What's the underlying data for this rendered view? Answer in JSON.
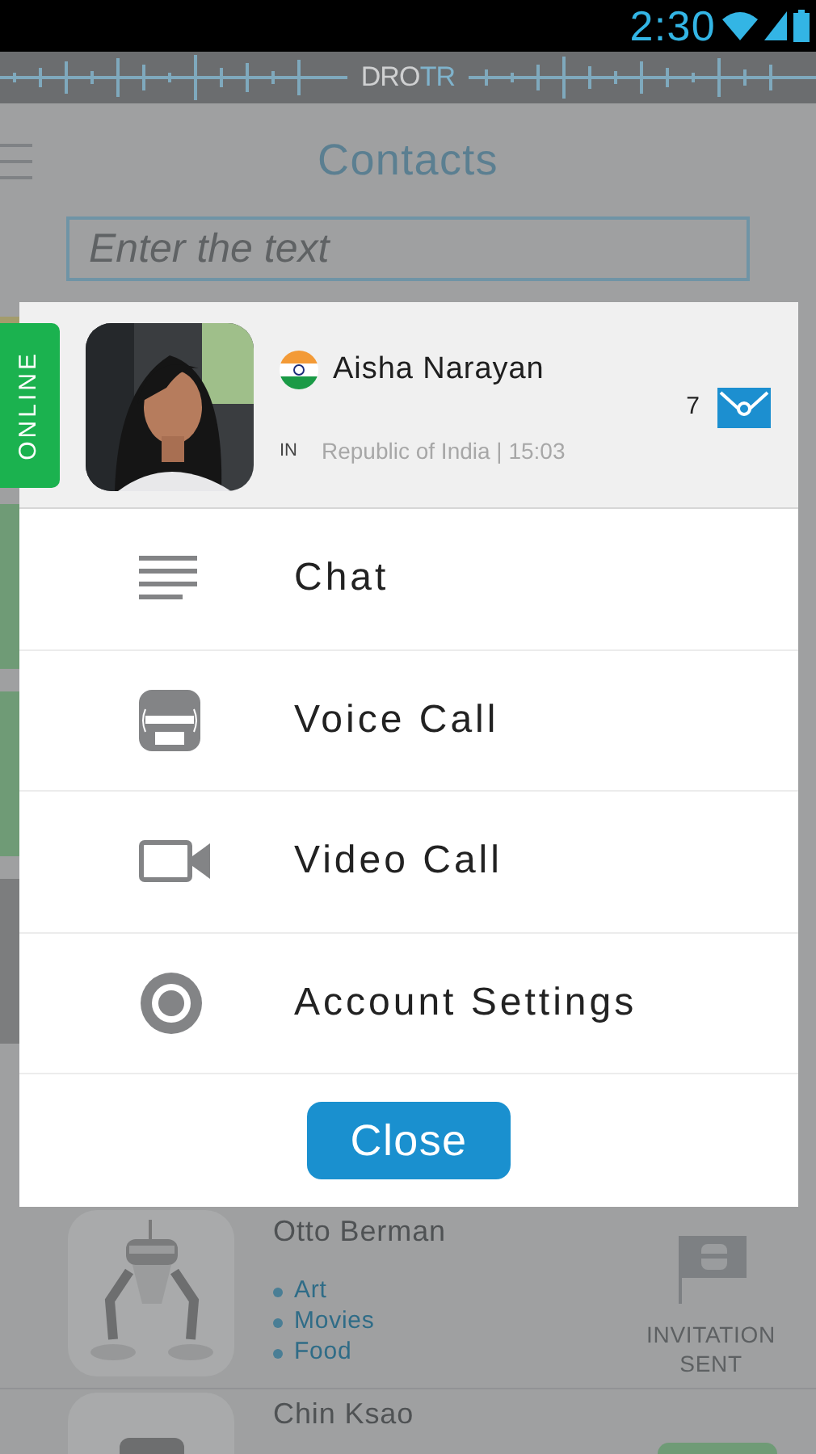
{
  "status_bar": {
    "time": "2:30"
  },
  "banner": {
    "logo": [
      {
        "text": "DRO",
        "accent": false
      },
      {
        "text": "TR",
        "accent": true
      }
    ]
  },
  "header": {
    "title": "Contacts"
  },
  "search": {
    "placeholder": "Enter the text"
  },
  "hidden_rows": [
    {
      "color": "#a39c6c"
    },
    {
      "color": "#6f9b76"
    },
    {
      "color": "#6f9b76"
    },
    {
      "color": "#7c7d7e"
    }
  ],
  "dialog": {
    "contact": {
      "status": "ONLINE",
      "name": "Aisha Narayan",
      "country_code": "IN",
      "location": "Republic of India | 15:03",
      "unread": "7"
    },
    "actions": [
      {
        "kind": "chat",
        "label": "Chat"
      },
      {
        "kind": "voice",
        "label": "Voice Call"
      },
      {
        "kind": "video",
        "label": "Video Call"
      },
      {
        "kind": "settings",
        "label": "Account Settings"
      }
    ],
    "close": "Close"
  },
  "contacts": [
    {
      "name": "Otto Berman",
      "tags": [
        "Art",
        "Movies",
        "Food"
      ],
      "invitation": "INVITATION SENT"
    },
    {
      "name": "Chin Ksao",
      "color": "#6f9b76"
    }
  ]
}
